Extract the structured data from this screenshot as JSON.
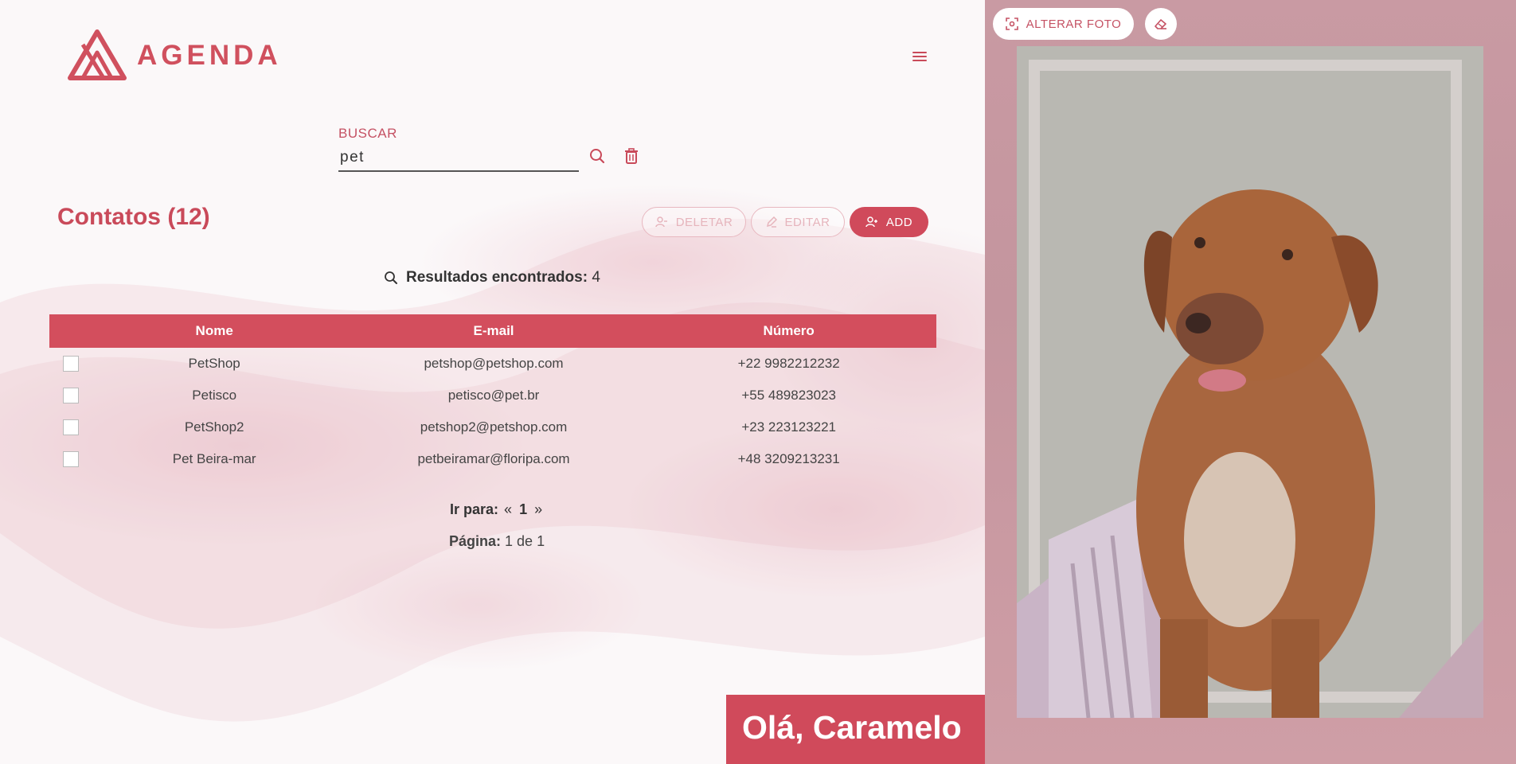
{
  "app": {
    "logo_text": "AGENDA"
  },
  "search": {
    "label": "BUSCAR",
    "value": "pet"
  },
  "contacts": {
    "title": "Contatos (12)"
  },
  "actions": {
    "delete_label": "DELETAR",
    "edit_label": "EDITAR",
    "add_label": "ADD"
  },
  "results": {
    "label": "Resultados encontrados:",
    "count": "4"
  },
  "table": {
    "headers": [
      "Nome",
      "E-mail",
      "Número"
    ],
    "rows": [
      {
        "name": "PetShop",
        "email": "petshop@petshop.com",
        "phone": "+22 9982212232"
      },
      {
        "name": "Petisco",
        "email": "petisco@pet.br",
        "phone": "+55 489823023"
      },
      {
        "name": "PetShop2",
        "email": "petshop2@petshop.com",
        "phone": "+23 223123221"
      },
      {
        "name": "Pet Beira-mar",
        "email": "petbeiramar@floripa.com",
        "phone": "+48 3209213231"
      }
    ]
  },
  "pagination": {
    "goto_label": "Ir para:",
    "prev": "«",
    "current": "1",
    "next": "»",
    "page_label": "Página:",
    "page_value": "1 de 1"
  },
  "greeting": "Olá, Caramelo",
  "photo_panel": {
    "change_photo_label": "ALTERAR FOTO"
  },
  "colors": {
    "accent": "#d04a5b",
    "panel_bg": "#c99aa3"
  },
  "icons": [
    "logo-mark-icon",
    "menu-icon",
    "search-icon",
    "trash-icon",
    "user-minus-icon",
    "pencil-icon",
    "user-plus-icon",
    "camera-focus-icon",
    "eraser-icon"
  ]
}
